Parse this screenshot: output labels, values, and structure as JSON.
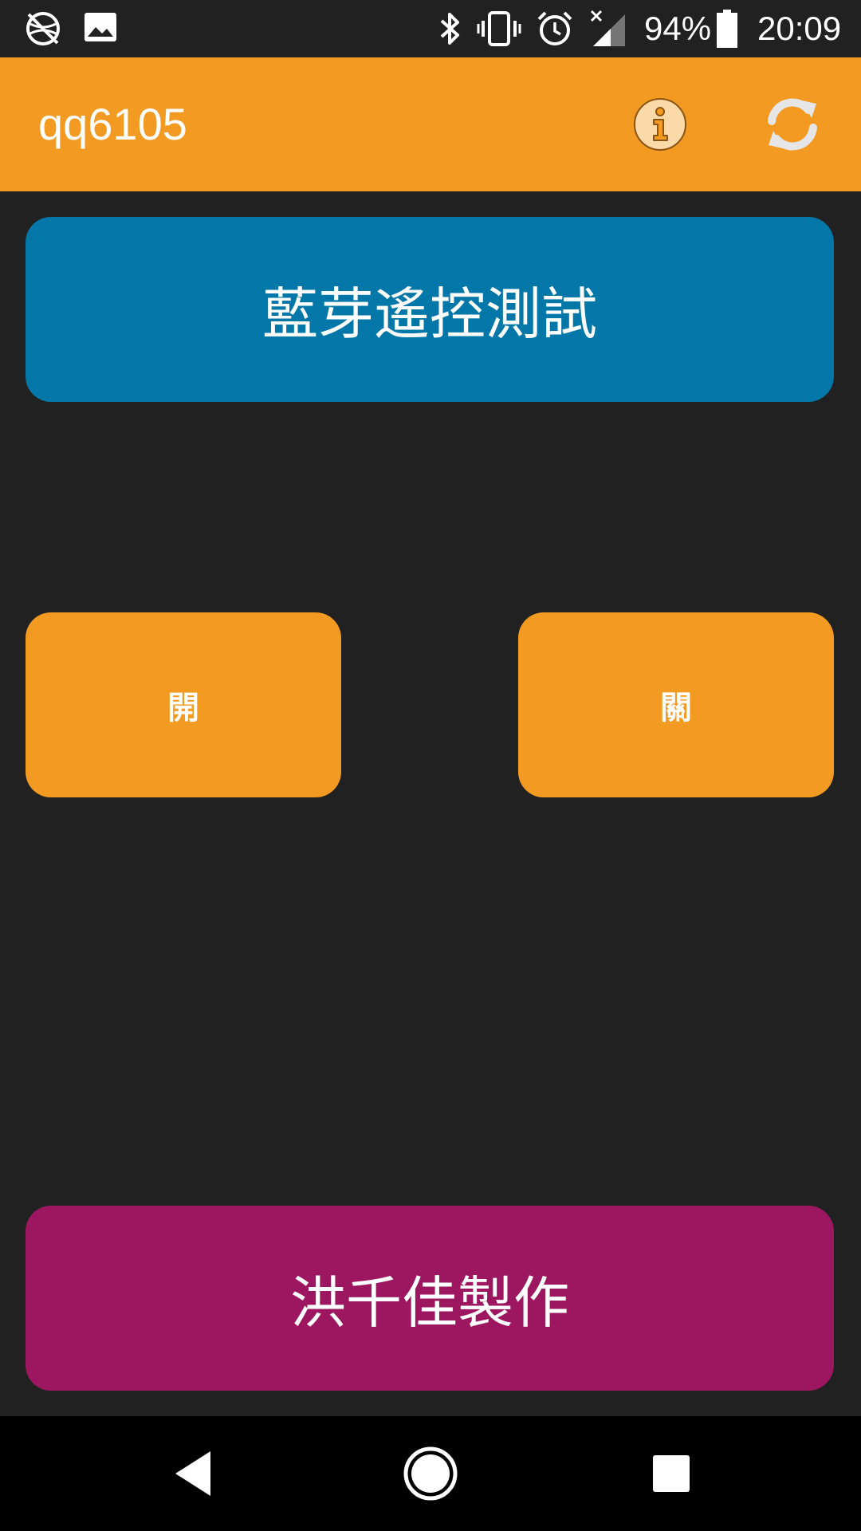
{
  "status_bar": {
    "battery_percent": "94%",
    "time": "20:09",
    "icons": [
      "no-data-icon",
      "image-icon",
      "bluetooth-icon",
      "vibrate-icon",
      "alarm-icon",
      "signal-icon",
      "battery-icon"
    ]
  },
  "app_bar": {
    "title": "qq6105",
    "info_icon": "info-icon",
    "refresh_icon": "refresh-icon"
  },
  "main": {
    "bluetooth_button_label": "藍芽遙控測試",
    "on_button_label": "開",
    "off_button_label": "關",
    "credit_button_label": "洪千佳製作"
  },
  "nav_bar": {
    "icons": [
      "back-icon",
      "home-icon",
      "recents-icon"
    ]
  },
  "colors": {
    "app_bar": "#F29A21",
    "bluetooth_button": "#0377A8",
    "toggle_buttons": "#F29A21",
    "credit_button": "#9D1760",
    "background": "#212121"
  }
}
